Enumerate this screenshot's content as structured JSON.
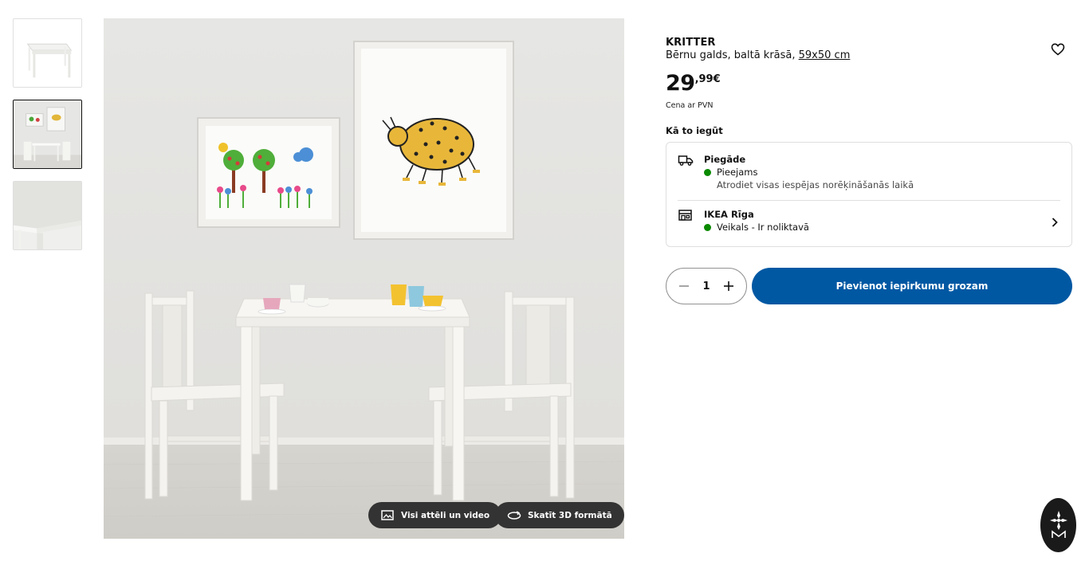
{
  "product": {
    "brand": "KRITTER",
    "description": "Bērnu galds, baltā krāsā,",
    "size": "59x50 cm",
    "price_int": "29",
    "price_dec": ",99€",
    "vat_note": "Cena ar PVN"
  },
  "fulfilment": {
    "heading": "Kā to iegūt",
    "delivery": {
      "title": "Piegāde",
      "status": "Pieejams",
      "note": "Atrodiet visas iespējas norēķināšanās laikā",
      "icon": "truck-icon",
      "status_color": "#0a8a00"
    },
    "store": {
      "title": "IKEA Rīga",
      "status": "Veikals - Ir noliktavā",
      "icon": "store-icon",
      "status_color": "#0a8a00"
    }
  },
  "purchase": {
    "quantity": "1",
    "add_to_cart": "Pievienot iepirkumu grozam",
    "button_color": "#0058a3"
  },
  "gallery": {
    "all_media_label": "Visi attēli un video",
    "view_3d_label": "Skatīt 3D formātā",
    "selected_thumbnail": 2,
    "thumbnail_count": 3
  }
}
